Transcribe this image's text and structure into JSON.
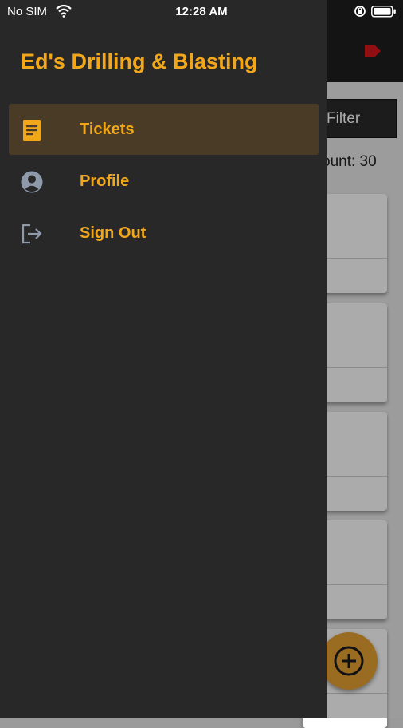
{
  "status_bar": {
    "carrier": "No SIM",
    "time": "12:28 AM"
  },
  "drawer": {
    "title": "Ed's Drilling & Blasting",
    "items": [
      {
        "label": "Tickets",
        "icon": "document-icon",
        "active": true
      },
      {
        "label": "Profile",
        "icon": "user-circle-icon",
        "active": false
      },
      {
        "label": "Sign Out",
        "icon": "sign-out-icon",
        "active": false
      }
    ]
  },
  "background": {
    "filter_label": "Filter",
    "count_text": "ount: 30"
  },
  "colors": {
    "accent": "#f2a71b",
    "drawer_bg": "#282828",
    "active_item_bg": "#4a3b26",
    "fab": "#e6a233",
    "logout_red": "#d8151b"
  }
}
